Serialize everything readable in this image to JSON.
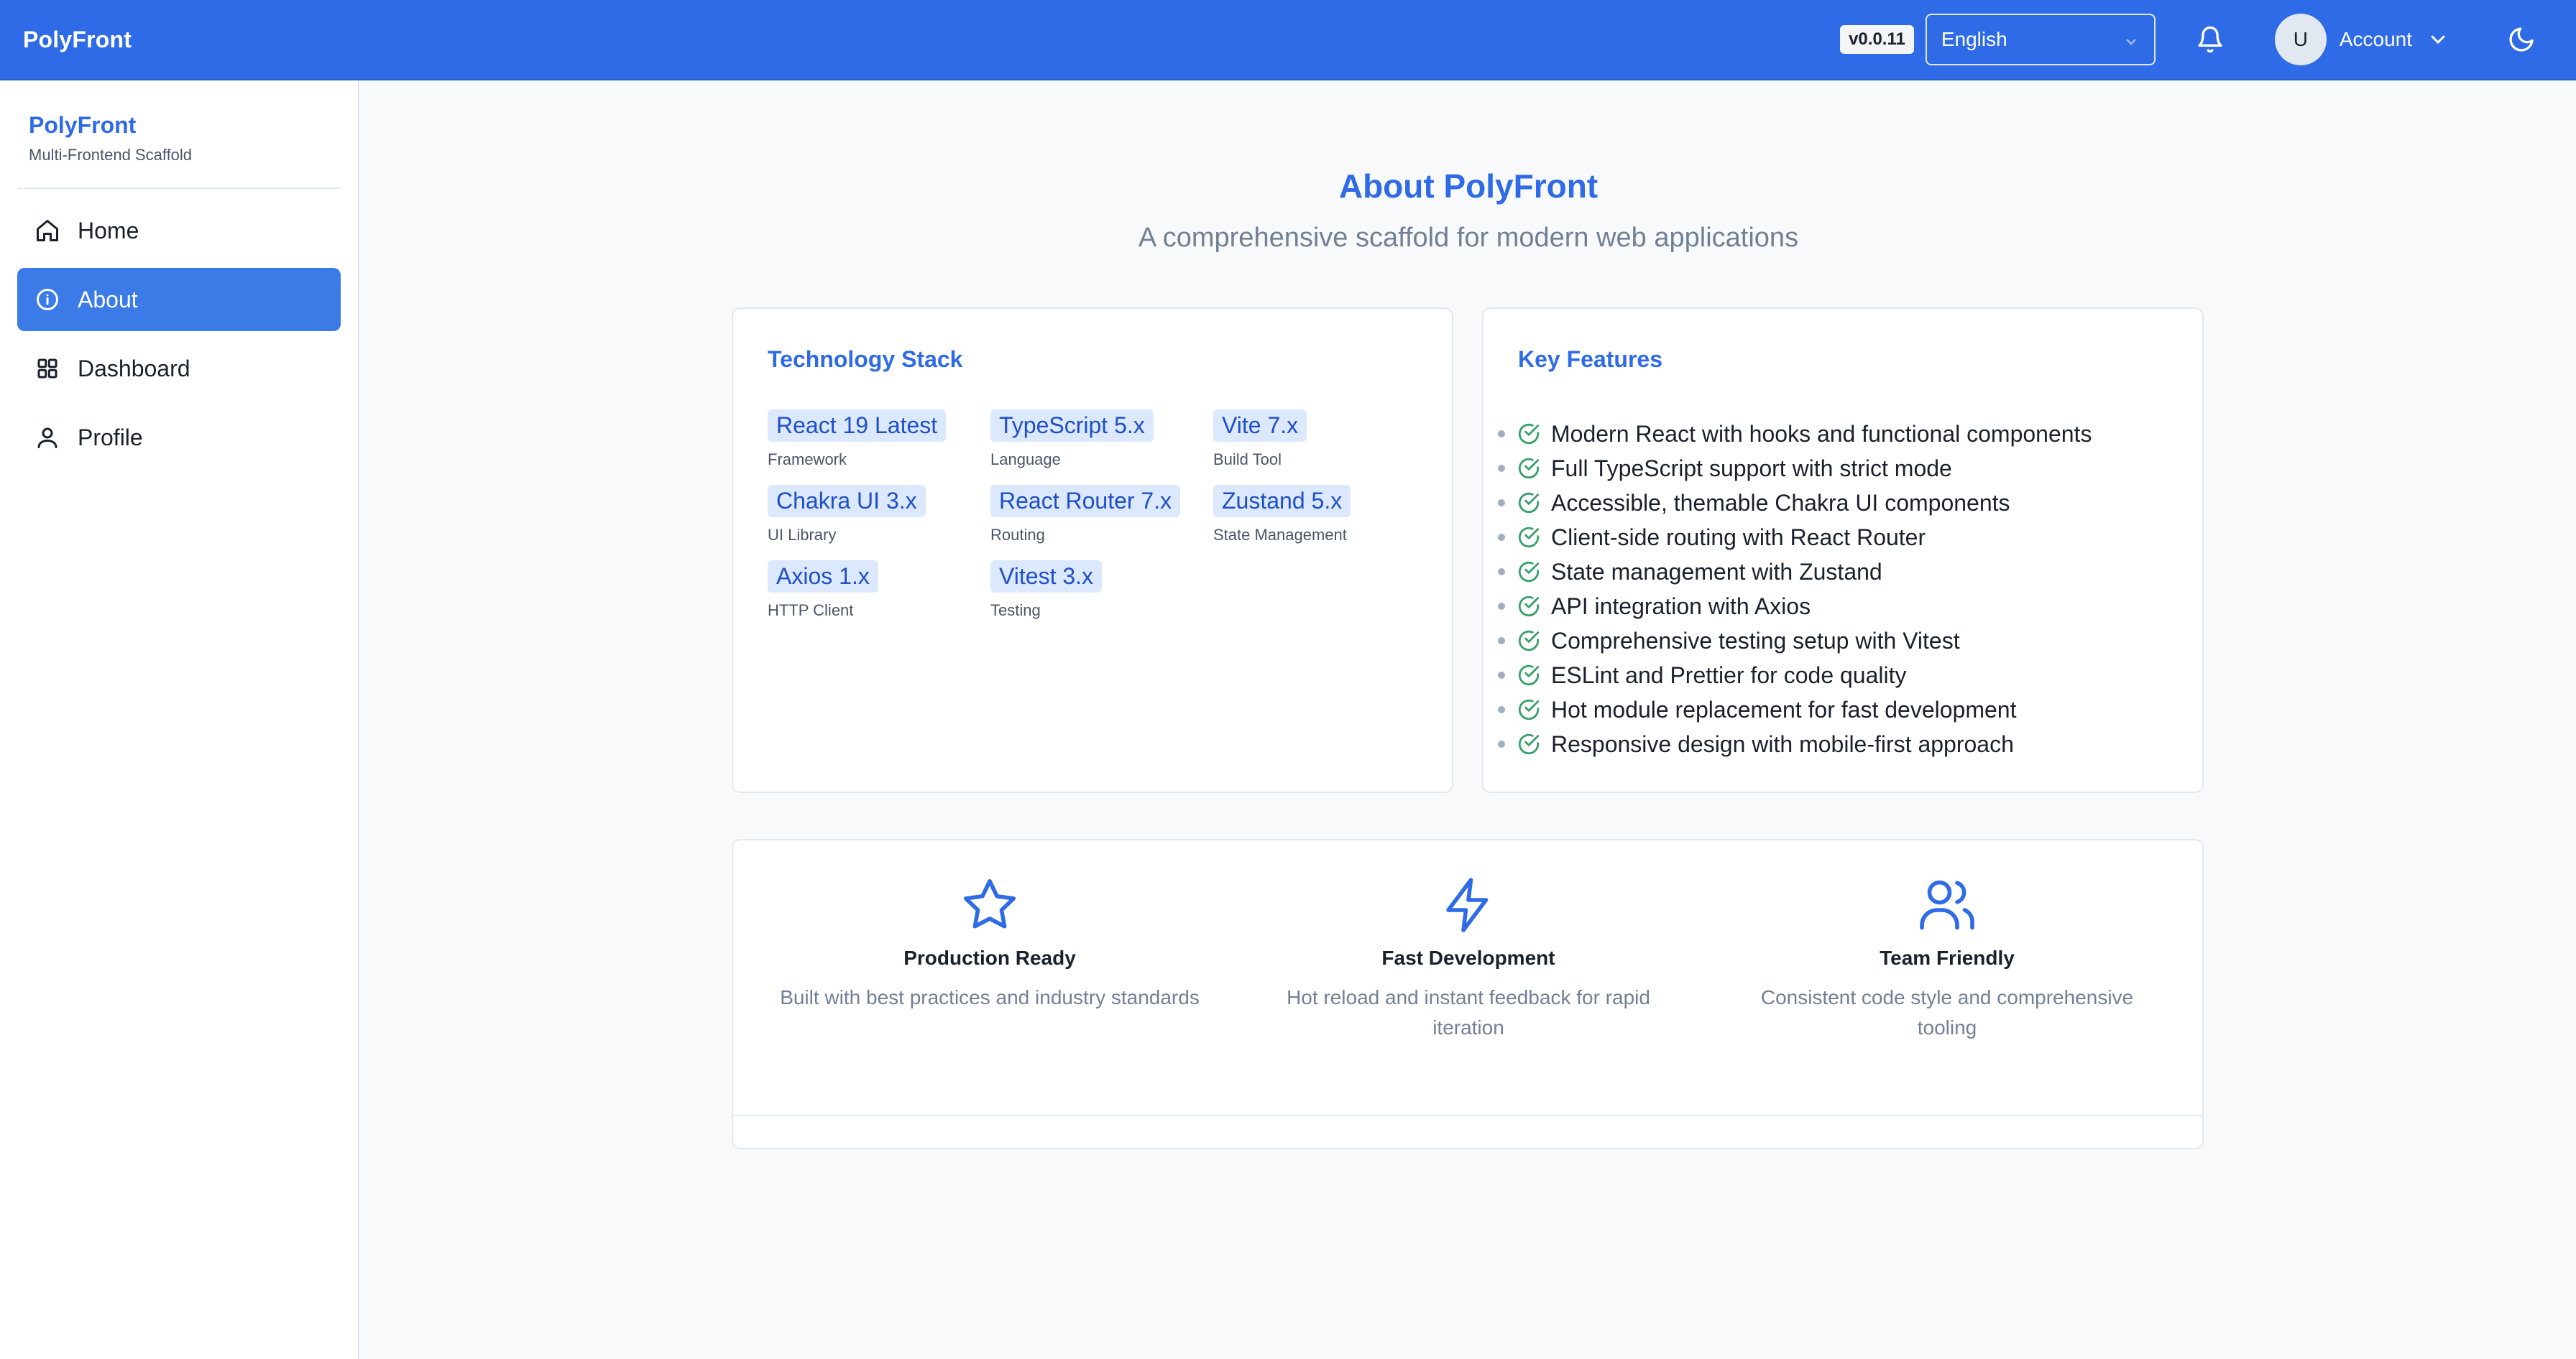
{
  "header": {
    "brand": "PolyFront",
    "version": "v0.0.11",
    "language": "English",
    "avatar_initial": "U",
    "account_label": "Account"
  },
  "sidebar": {
    "title": "PolyFront",
    "subtitle": "Multi-Frontend Scaffold",
    "items": [
      {
        "label": "Home",
        "icon": "home-icon",
        "active": false
      },
      {
        "label": "About",
        "icon": "info-icon",
        "active": true
      },
      {
        "label": "Dashboard",
        "icon": "grid-icon",
        "active": false
      },
      {
        "label": "Profile",
        "icon": "user-icon",
        "active": false
      }
    ]
  },
  "main": {
    "title": "About PolyFront",
    "subtitle": "A comprehensive scaffold for modern web applications",
    "tech": {
      "title": "Technology Stack",
      "items": [
        {
          "name": "React 19 Latest",
          "category": "Framework"
        },
        {
          "name": "TypeScript 5.x",
          "category": "Language"
        },
        {
          "name": "Vite 7.x",
          "category": "Build Tool"
        },
        {
          "name": "Chakra UI 3.x",
          "category": "UI Library"
        },
        {
          "name": "React Router 7.x",
          "category": "Routing"
        },
        {
          "name": "Zustand 5.x",
          "category": "State Management"
        },
        {
          "name": "Axios 1.x",
          "category": "HTTP Client"
        },
        {
          "name": "Vitest 3.x",
          "category": "Testing"
        }
      ]
    },
    "features": {
      "title": "Key Features",
      "items": [
        "Modern React with hooks and functional components",
        "Full TypeScript support with strict mode",
        "Accessible, themable Chakra UI components",
        "Client-side routing with React Router",
        "State management with Zustand",
        "API integration with Axios",
        "Comprehensive testing setup with Vitest",
        "ESLint and Prettier for code quality",
        "Hot module replacement for fast development",
        "Responsive design with mobile-first approach"
      ]
    },
    "highlights": [
      {
        "icon": "star-icon",
        "title": "Production Ready",
        "desc": "Built with best practices and industry standards"
      },
      {
        "icon": "lightning-icon",
        "title": "Fast Development",
        "desc": "Hot reload and instant feedback for rapid iteration"
      },
      {
        "icon": "users-icon",
        "title": "Team Friendly",
        "desc": "Consistent code style and comprehensive tooling"
      }
    ]
  },
  "colors": {
    "primary": "#2f6be6",
    "active_nav": "#3b7be8",
    "tag_bg": "#dbe8fd",
    "check": "#38a169"
  }
}
